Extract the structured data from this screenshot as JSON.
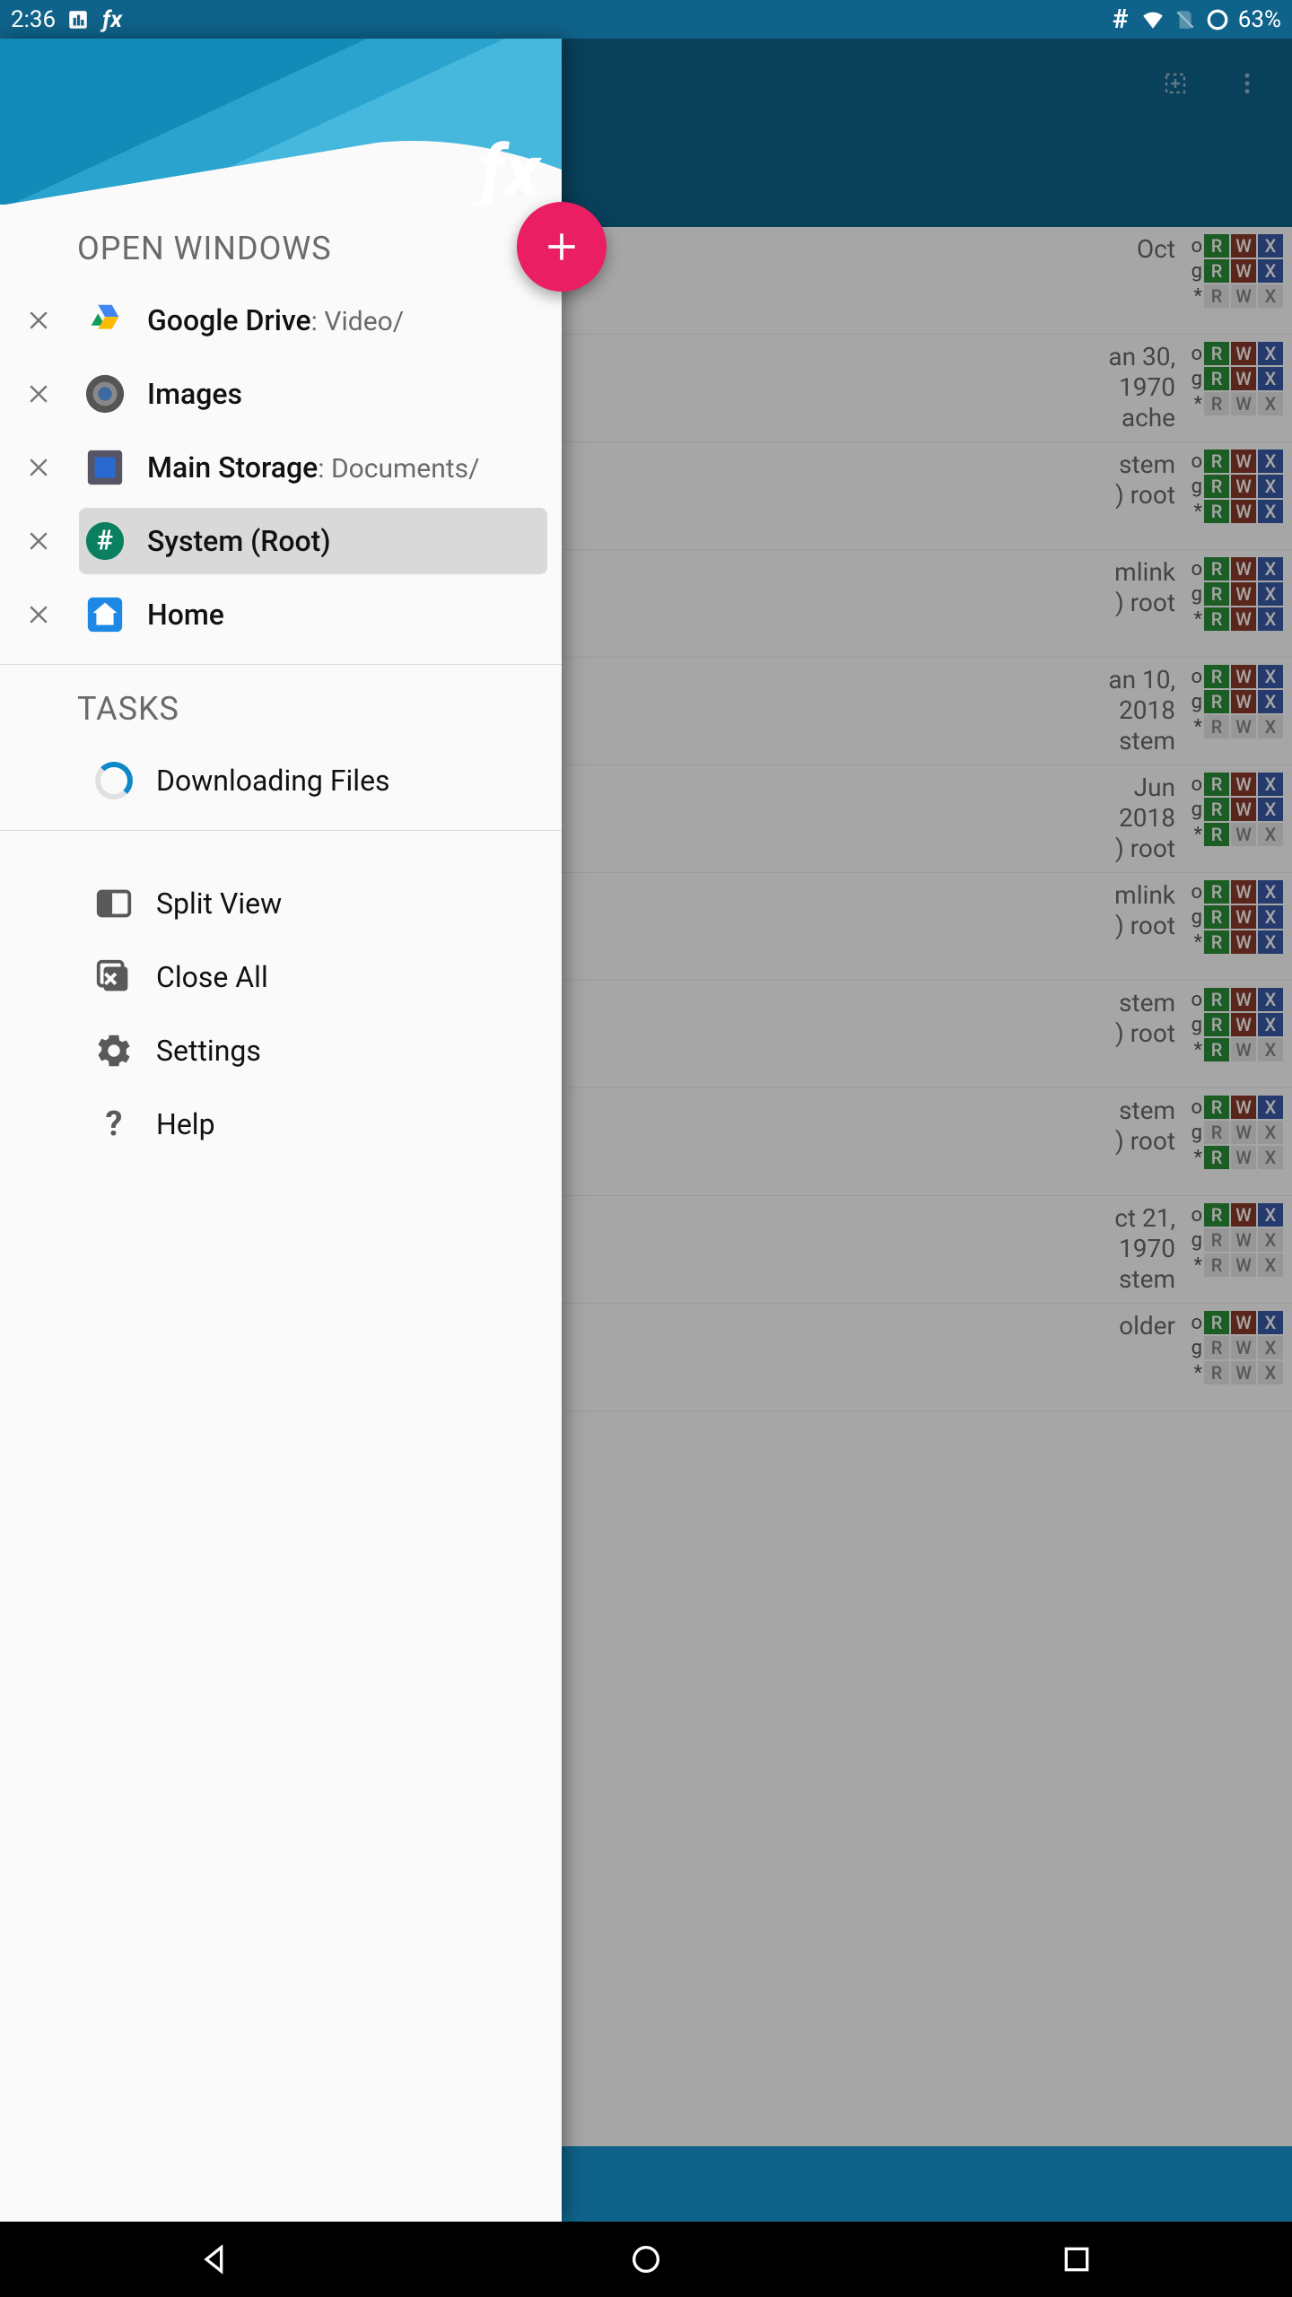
{
  "statusbar": {
    "time": "2:36",
    "battery_pct": "63%"
  },
  "actionbar": {
    "title": ""
  },
  "drawer": {
    "open_windows_title": "OPEN WINDOWS",
    "windows": [
      {
        "name": "Google Drive",
        "path": ": Video/",
        "icon": "gdrive",
        "selected": false
      },
      {
        "name": "Images",
        "path": "",
        "icon": "images",
        "selected": false
      },
      {
        "name": "Main Storage",
        "path": ": Documents/",
        "icon": "storage",
        "selected": false
      },
      {
        "name": "System (Root)",
        "path": "",
        "icon": "root",
        "selected": true
      },
      {
        "name": "Home",
        "path": "",
        "icon": "home",
        "selected": false
      }
    ],
    "tasks_title": "TASKS",
    "tasks": [
      {
        "label": "Downloading Files"
      }
    ],
    "actions": {
      "split_view": "Split View",
      "close_all": "Close All",
      "settings": "Settings",
      "help": "Help"
    }
  },
  "bg_rows": [
    {
      "l1": "Oct",
      "l2": "",
      "l3": "",
      "perm_o": "RWX",
      "perm_g": "RWX",
      "perm_s": ""
    },
    {
      "l1": "an 30,",
      "l2": "1970",
      "l3": "ache",
      "perm_o": "RWX",
      "perm_g": "RWX",
      "perm_s": ""
    },
    {
      "l1": "stem",
      "l2": ") root",
      "l3": "",
      "perm_o": "RWX",
      "perm_g": "RWX",
      "perm_s": "RWX"
    },
    {
      "l1": "mlink",
      "l2": ") root",
      "l3": "",
      "perm_o": "RWX",
      "perm_g": "RWX",
      "perm_s": "RWX"
    },
    {
      "l1": "an 10,",
      "l2": "2018",
      "l3": "stem",
      "perm_o": "RWX",
      "perm_g": "RWX",
      "perm_s": ""
    },
    {
      "l1": "Jun",
      "l2": "2018",
      "l3": ") root",
      "perm_o": "RWX",
      "perm_g": "RWX",
      "perm_s": "R"
    },
    {
      "l1": "mlink",
      "l2": ") root",
      "l3": "",
      "perm_o": "RWX",
      "perm_g": "RWX",
      "perm_s": "RWX"
    },
    {
      "l1": "stem",
      "l2": ") root",
      "l3": "",
      "perm_o": "RWX",
      "perm_g": "RWX",
      "perm_s": "R"
    },
    {
      "l1": "stem",
      "l2": ") root",
      "l3": "",
      "perm_o": "RWX",
      "perm_g": "",
      "perm_s": "R"
    },
    {
      "l1": "ct 21,",
      "l2": "1970",
      "l3": "stem",
      "perm_o": "RWX",
      "perm_g": "",
      "perm_s": ""
    },
    {
      "l1": "older",
      "l2": "",
      "l3": "",
      "perm_o": "RWX",
      "perm_g": "",
      "perm_s": ""
    }
  ]
}
